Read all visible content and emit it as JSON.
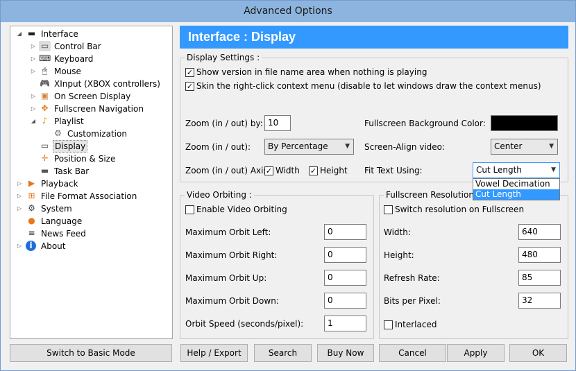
{
  "window": {
    "title": "Advanced Options"
  },
  "tree": {
    "items": [
      {
        "label": "Interface",
        "icon": "interface-icon",
        "level": 0,
        "expander": "minus"
      },
      {
        "label": "Control Bar",
        "icon": "control-bar-icon",
        "level": 1,
        "expander": "collapsed"
      },
      {
        "label": "Keyboard",
        "icon": "keyboard-icon",
        "level": 1,
        "expander": "collapsed"
      },
      {
        "label": "Mouse",
        "icon": "mouse-icon",
        "level": 1,
        "expander": "collapsed"
      },
      {
        "label": "XInput (XBOX controllers)",
        "icon": "gamepad-icon",
        "level": 1,
        "expander": "none"
      },
      {
        "label": "On Screen Display",
        "icon": "osd-icon",
        "level": 1,
        "expander": "collapsed"
      },
      {
        "label": "Fullscreen Navigation",
        "icon": "fullscreen-nav-icon",
        "level": 1,
        "expander": "collapsed"
      },
      {
        "label": "Playlist",
        "icon": "playlist-icon",
        "level": 1,
        "expander": "expanded"
      },
      {
        "label": "Customization",
        "icon": "customization-icon",
        "level": 2,
        "expander": "none"
      },
      {
        "label": "Display",
        "icon": "display-icon",
        "level": 1,
        "expander": "none",
        "selected": true
      },
      {
        "label": "Position & Size",
        "icon": "position-size-icon",
        "level": 1,
        "expander": "none"
      },
      {
        "label": "Task Bar",
        "icon": "task-bar-icon",
        "level": 1,
        "expander": "none"
      },
      {
        "label": "Playback",
        "icon": "playback-icon",
        "level": 0,
        "expander": "collapsed"
      },
      {
        "label": "File Format Association",
        "icon": "file-format-icon",
        "level": 0,
        "expander": "collapsed"
      },
      {
        "label": "System",
        "icon": "system-gear-icon",
        "level": 0,
        "expander": "collapsed"
      },
      {
        "label": "Language",
        "icon": "language-icon",
        "level": 0,
        "expander": "none"
      },
      {
        "label": "News Feed",
        "icon": "news-feed-icon",
        "level": 0,
        "expander": "none"
      },
      {
        "label": "About",
        "icon": "about-info-icon",
        "level": 0,
        "expander": "collapsed"
      }
    ]
  },
  "header": {
    "title": "Interface : Display"
  },
  "display_settings": {
    "title": "Display Settings :",
    "show_version": {
      "label": "Show version in file name area when nothing is playing",
      "checked": true
    },
    "skin_menu": {
      "label": "Skin the right-click context menu (disable to let windows draw the context menus)",
      "checked": true
    },
    "zoom_by_label": "Zoom (in / out) by:",
    "zoom_by_value": "10",
    "zoom_label": "Zoom (in / out):",
    "zoom_value": "By Percentage",
    "zoom_axis_label": "Zoom (in / out) Axis:",
    "zoom_axis_width": {
      "label": "Width",
      "checked": true
    },
    "zoom_axis_height": {
      "label": "Height",
      "checked": true
    },
    "fs_bg_label": "Fullscreen Background Color:",
    "fs_bg_color": "#000000",
    "screen_align_label": "Screen-Align video:",
    "screen_align_value": "Center",
    "fit_text_label": "Fit Text Using:",
    "fit_text_value": "Cut Length",
    "fit_text_options": [
      "Vowel Decimation",
      "Cut Length"
    ],
    "fit_text_highlighted": "Cut Length"
  },
  "orbiting": {
    "title": "Video Orbiting :",
    "enable": {
      "label": "Enable Video Orbiting",
      "checked": false
    },
    "fields": [
      {
        "label": "Maximum Orbit Left:",
        "value": "0"
      },
      {
        "label": "Maximum Orbit Right:",
        "value": "0"
      },
      {
        "label": "Maximum Orbit Up:",
        "value": "0"
      },
      {
        "label": "Maximum Orbit Down:",
        "value": "0"
      },
      {
        "label": "Orbit Speed (seconds/pixel):",
        "value": "1"
      }
    ]
  },
  "fullscreen_res": {
    "title": "Fullscreen Resolution :",
    "switch": {
      "label": "Switch resolution on Fullscreen",
      "checked": false
    },
    "fields": [
      {
        "label": "Width:",
        "value": "640"
      },
      {
        "label": "Height:",
        "value": "480"
      },
      {
        "label": "Refresh Rate:",
        "value": "85"
      },
      {
        "label": "Bits per Pixel:",
        "value": "32"
      }
    ],
    "interlaced": {
      "label": "Interlaced",
      "checked": false
    }
  },
  "buttons": {
    "basic_mode": "Switch to Basic Mode",
    "help_export": "Help / Export",
    "search": "Search",
    "buy_now": "Buy Now",
    "cancel": "Cancel",
    "apply": "Apply",
    "ok": "OK"
  },
  "colors": {
    "header_bg": "#3399ff",
    "selection": "#3399ff",
    "titlebar": "#8cb4de"
  }
}
